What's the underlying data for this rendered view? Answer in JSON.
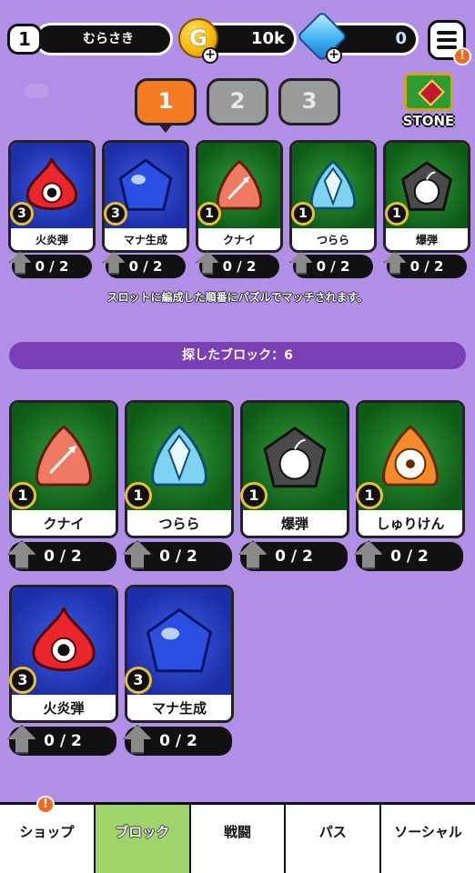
{
  "header": {
    "player_level": "1",
    "player_name": "むらさき",
    "gold": "10k",
    "gems": "0",
    "menu_alert": "!"
  },
  "slot_tabs": [
    {
      "label": "1",
      "active": true
    },
    {
      "label": "2",
      "active": false
    },
    {
      "label": "3",
      "active": false
    }
  ],
  "stone_button": {
    "label": "STONE"
  },
  "equipped": [
    {
      "name": "火炎弾",
      "level": "3",
      "progress": "0 / 2",
      "bg": "blue",
      "icon": "flame-blob"
    },
    {
      "name": "マナ生成",
      "level": "3",
      "progress": "0 / 2",
      "bg": "blue",
      "icon": "mana-blob"
    },
    {
      "name": "クナイ",
      "level": "1",
      "progress": "0 / 2",
      "bg": "green",
      "icon": "kunai-blob"
    },
    {
      "name": "つらら",
      "level": "1",
      "progress": "0 / 2",
      "bg": "green",
      "icon": "icicle-blob"
    },
    {
      "name": "爆弾",
      "level": "1",
      "progress": "0 / 2",
      "bg": "green",
      "icon": "bomb-blob"
    }
  ],
  "hint_text": "スロットに編成した順番にパズルでマッチされます。",
  "found_bar": "探したブロック：6",
  "found_blocks": [
    {
      "name": "クナイ",
      "level": "1",
      "progress": "0 / 2",
      "bg": "green",
      "icon": "kunai-blob"
    },
    {
      "name": "つらら",
      "level": "1",
      "progress": "0 / 2",
      "bg": "green",
      "icon": "icicle-blob"
    },
    {
      "name": "爆弾",
      "level": "1",
      "progress": "0 / 2",
      "bg": "green",
      "icon": "bomb-blob"
    },
    {
      "name": "しゅりけん",
      "level": "1",
      "progress": "0 / 2",
      "bg": "green",
      "icon": "shuriken-blob"
    },
    {
      "name": "火炎弾",
      "level": "3",
      "progress": "0 / 2",
      "bg": "blue",
      "icon": "flame-blob"
    },
    {
      "name": "マナ生成",
      "level": "3",
      "progress": "0 / 2",
      "bg": "blue",
      "icon": "mana-blob"
    }
  ],
  "nav": [
    {
      "label": "ショップ",
      "active": false,
      "alert": "!"
    },
    {
      "label": "ブロック",
      "active": true
    },
    {
      "label": "戦闘",
      "active": false
    },
    {
      "label": "パス",
      "active": false
    },
    {
      "label": "ソーシャル",
      "active": false
    }
  ],
  "colors": {
    "background": "#b18fe6",
    "active_tab": "#f57c24",
    "active_nav": "#9fd46b",
    "found_bar": "#7a3fb5"
  }
}
